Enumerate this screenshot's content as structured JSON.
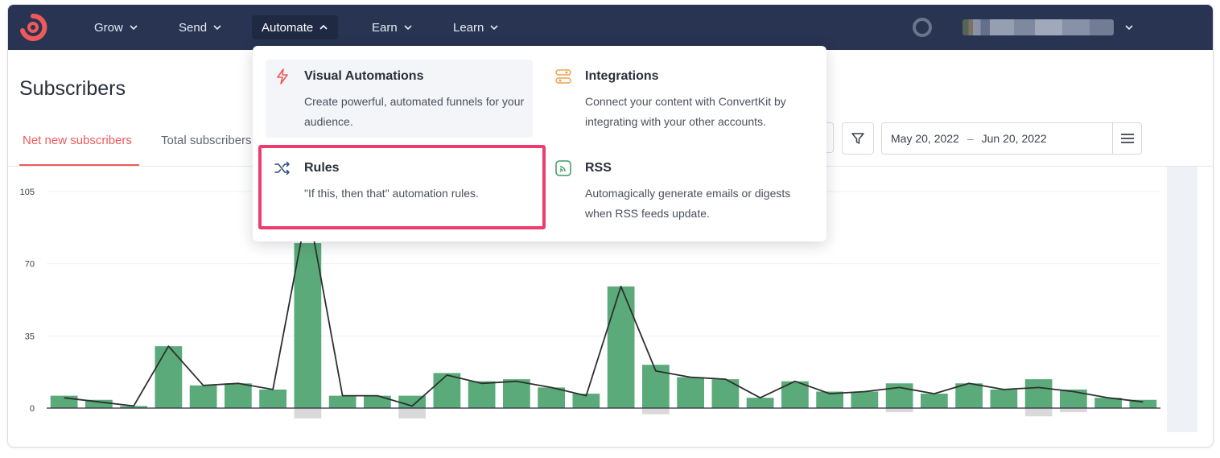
{
  "nav": {
    "items": [
      {
        "label": "Grow"
      },
      {
        "label": "Send"
      },
      {
        "label": "Automate"
      },
      {
        "label": "Earn"
      },
      {
        "label": "Learn"
      }
    ]
  },
  "page": {
    "title": "Subscribers",
    "tabs": [
      {
        "label": "Net new subscribers"
      },
      {
        "label": "Total subscribers"
      }
    ]
  },
  "date_range": {
    "start": "May 20, 2022",
    "separator": "–",
    "end": "Jun 20, 2022"
  },
  "dropdown": {
    "items": [
      {
        "title": "Visual Automations",
        "desc": "Create powerful, automated funnels for your audience.",
        "icon": "lightning-icon",
        "color": "#ef5a5a"
      },
      {
        "title": "Integrations",
        "desc": "Connect your content with ConvertKit by integrating with your other accounts.",
        "icon": "integrations-icon",
        "color": "#f0a14a"
      },
      {
        "title": "Rules",
        "desc": "\"If this, then that\" automation rules.",
        "icon": "shuffle-icon",
        "color": "#2f4a7c"
      },
      {
        "title": "RSS",
        "desc": "Automagically generate emails or digests when RSS feeds update.",
        "icon": "rss-icon",
        "color": "#3a9a63"
      }
    ]
  },
  "colors": {
    "nav_bg": "#283452",
    "accent": "#ef5a5a",
    "bar": "#5aab79",
    "negative_bar": "#d9d9d9",
    "highlight_outline": "#ee3c6f"
  },
  "chart_data": {
    "type": "bar",
    "ylim": [
      0,
      105
    ],
    "yticks": [
      "105",
      "70",
      "35",
      "0"
    ],
    "bars": [
      6,
      4,
      1,
      30,
      11,
      12,
      9,
      80,
      6,
      6,
      6,
      17,
      13,
      14,
      10,
      7,
      59,
      21,
      15,
      14,
      5,
      13,
      8,
      8,
      12,
      7,
      12,
      9,
      14,
      9,
      5,
      4
    ],
    "negatives": [
      0,
      0,
      0,
      0,
      0,
      0,
      0,
      -5,
      0,
      0,
      -5,
      0,
      0,
      0,
      0,
      0,
      0,
      -3,
      0,
      0,
      0,
      0,
      0,
      0,
      -2,
      0,
      0,
      0,
      -4,
      -2,
      0,
      0
    ],
    "line": [
      5,
      3,
      1,
      30,
      11,
      12,
      9,
      98,
      6,
      6,
      1,
      16,
      12,
      13,
      10,
      6,
      59,
      18,
      15,
      14,
      5,
      13,
      7,
      8,
      10,
      7,
      12,
      9,
      10,
      8,
      5,
      3
    ]
  }
}
